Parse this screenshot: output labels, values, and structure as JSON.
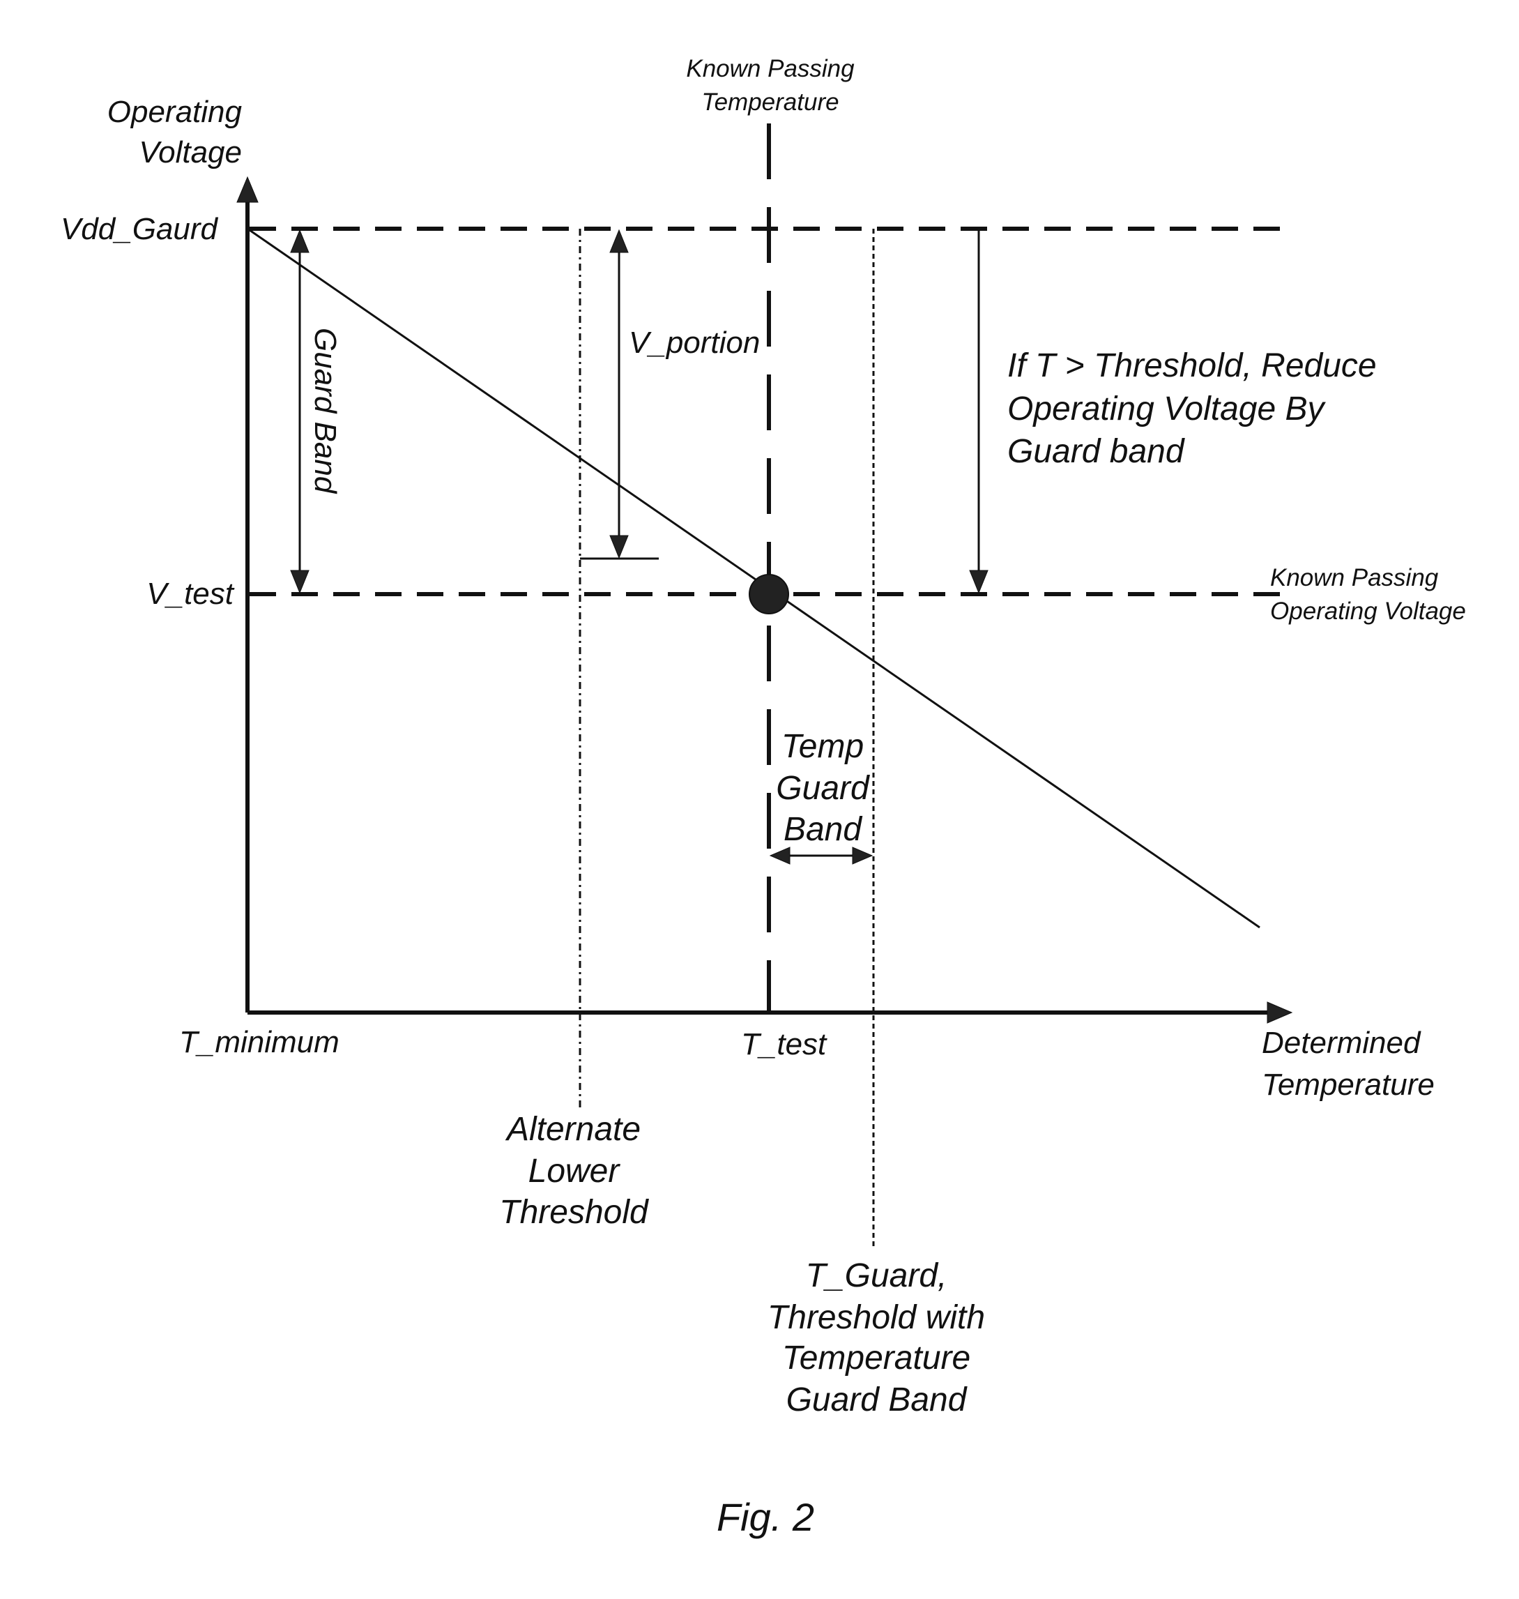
{
  "figure": {
    "caption": "Fig. 2",
    "y_axis": {
      "label_line1": "Operating",
      "label_line2": "Voltage"
    },
    "x_axis": {
      "label_line1": "Determined",
      "label_line2": "Temperature"
    },
    "levels": {
      "vdd_guard": "Vdd_Gaurd",
      "v_test": "V_test",
      "t_minimum": "T_minimum",
      "t_test": "T_test"
    },
    "annotations": {
      "known_passing_temperature": [
        "Known Passing",
        "Temperature"
      ],
      "known_passing_voltage": [
        "Known Passing",
        "Operating Voltage"
      ],
      "guard_band": "Guard Band",
      "v_portion": "V_portion",
      "reduce_rule": [
        "If T > Threshold, Reduce",
        "Operating Voltage By",
        "Guard band"
      ],
      "temp_guard_band": [
        "Temp",
        "Guard",
        "Band"
      ],
      "alternate_lower_threshold": [
        "Alternate",
        "Lower",
        "Threshold"
      ],
      "t_guard": [
        "T_Guard,",
        "Threshold with",
        "Temperature",
        "Guard Band"
      ]
    },
    "relationships": {
      "curve": "Operating voltage decreases linearly with determined temperature, starting at Vdd_Gaurd at T_minimum",
      "known_passing_point": "Intersection of T_test and V_test lies on the curve",
      "guard_band_span": "Vdd_Gaurd minus V_test",
      "temp_guard_band_span": "T_test to T_Guard"
    }
  }
}
